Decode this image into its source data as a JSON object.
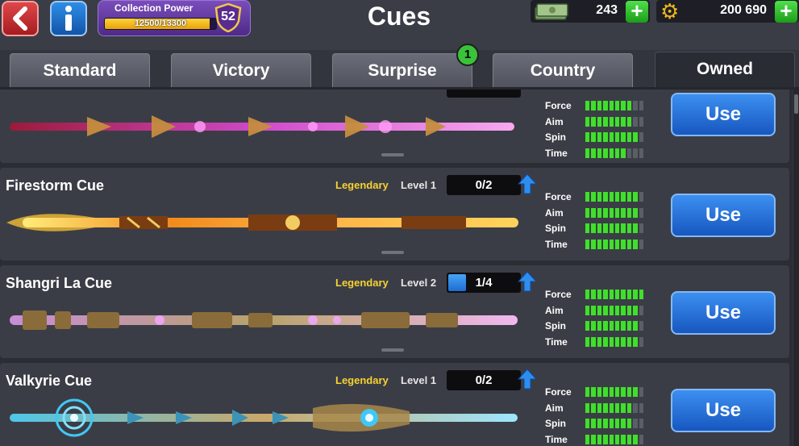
{
  "header": {
    "title": "Cues",
    "collection_power": {
      "label": "Collection Power",
      "progress_text": "12500/13300",
      "progress_fraction": 0.94,
      "level": "52"
    },
    "cash": "243",
    "coins": "200 690",
    "icons": {
      "back": "back-arrow-icon",
      "info": "info-icon",
      "cash": "banknote-icon",
      "coins": "gear-coin-icon",
      "plus": "plus-icon"
    },
    "colors": {
      "accent_green": "#3fe02a",
      "use_button": "#1f6cd0",
      "legendary": "#f6d232",
      "collection_purple": "#6a3fae"
    }
  },
  "tabs": [
    {
      "label": "Standard",
      "active": false
    },
    {
      "label": "Victory",
      "active": false
    },
    {
      "label": "Surprise",
      "active": false,
      "badge": "1"
    },
    {
      "label": "Country",
      "active": false
    },
    {
      "label": "Owned",
      "active": true
    }
  ],
  "stat_labels": [
    "Force",
    "Aim",
    "Spin",
    "Time"
  ],
  "cues": [
    {
      "name": "",
      "rarity": "",
      "level": "",
      "progress_text": "",
      "progress_fraction": 0,
      "stats": [
        8,
        8,
        9,
        7
      ],
      "use_label": "Use"
    },
    {
      "name": "Firestorm Cue",
      "rarity": "Legendary",
      "level": "Level 1",
      "progress_text": "0/2",
      "progress_fraction": 0,
      "stats": [
        9,
        9,
        9,
        9
      ],
      "use_label": "Use"
    },
    {
      "name": "Shangri La Cue",
      "rarity": "Legendary",
      "level": "Level 2",
      "progress_text": "1/4",
      "progress_fraction": 0.25,
      "stats": [
        10,
        9,
        9,
        9
      ],
      "use_label": "Use"
    },
    {
      "name": "Valkyrie Cue",
      "rarity": "Legendary",
      "level": "Level 1",
      "progress_text": "0/2",
      "progress_fraction": 0,
      "stats": [
        9,
        8,
        8,
        9
      ],
      "use_label": "Use"
    }
  ]
}
